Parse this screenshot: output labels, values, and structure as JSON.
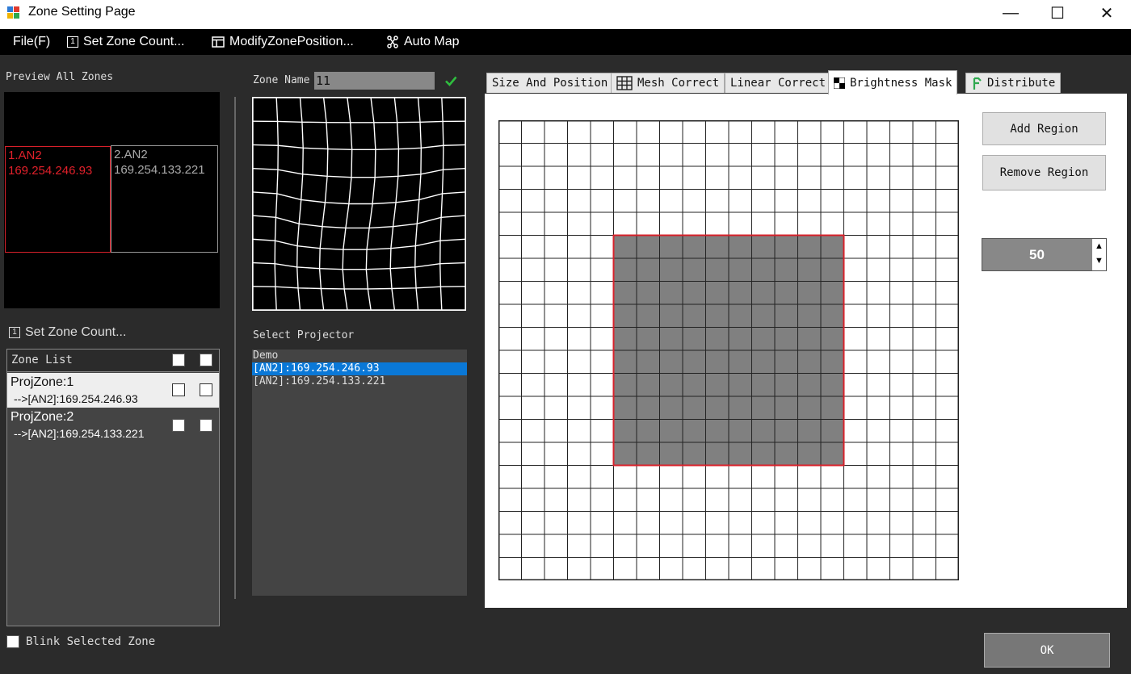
{
  "window": {
    "title": "Zone Setting Page",
    "controls": {
      "minimize": "—",
      "maximize": "☐",
      "close": "✕"
    }
  },
  "menu": {
    "file": "File(F)",
    "set_zone_count": "Set Zone Count...",
    "modify_zone_position": "ModifyZonePosition...",
    "auto_map": "Auto Map"
  },
  "preview": {
    "label": "Preview All Zones",
    "zones": [
      {
        "name": "1.AN2",
        "ip": "169.254.246.93",
        "color": "#e0202a"
      },
      {
        "name": "2.AN2",
        "ip": "169.254.133.221",
        "color": "#aaaaaa"
      }
    ]
  },
  "set_zone_count_link": "Set Zone Count...",
  "zone_list": {
    "header": "Zone List",
    "rows": [
      {
        "name": "ProjZone:1",
        "projector": "-->[AN2]:169.254.246.93",
        "selected": true
      },
      {
        "name": "ProjZone:2",
        "projector": "-->[AN2]:169.254.133.221",
        "selected": false
      }
    ]
  },
  "blink_label": "Blink Selected Zone",
  "zone_name": {
    "label": "Zone Name",
    "value": "11"
  },
  "select_projector": {
    "label": "Select Projector",
    "items": [
      {
        "text": "Demo",
        "selected": false
      },
      {
        "text": "[AN2]:169.254.246.93",
        "selected": true
      },
      {
        "text": "[AN2]:169.254.133.221",
        "selected": false
      }
    ]
  },
  "tabs": [
    {
      "label": "Size And Position",
      "active": false
    },
    {
      "label": "Mesh Correct",
      "active": false
    },
    {
      "label": "Linear Correct",
      "active": false
    },
    {
      "label": "Brightness Mask",
      "active": true
    },
    {
      "label": "Distribute",
      "active": false
    }
  ],
  "brightness_mask": {
    "add_region": "Add Region",
    "remove_region": "Remove Region",
    "brightness_value": "50",
    "grid_cells": 20,
    "region": {
      "col_start": 5,
      "row_start": 5,
      "col_end": 15,
      "row_end": 15
    },
    "region_fill": "#808080",
    "region_border": "#d8202a"
  },
  "ok_label": "OK",
  "colors": {
    "accent_selection": "#0a78d7",
    "check_green": "#2fbf3f"
  }
}
